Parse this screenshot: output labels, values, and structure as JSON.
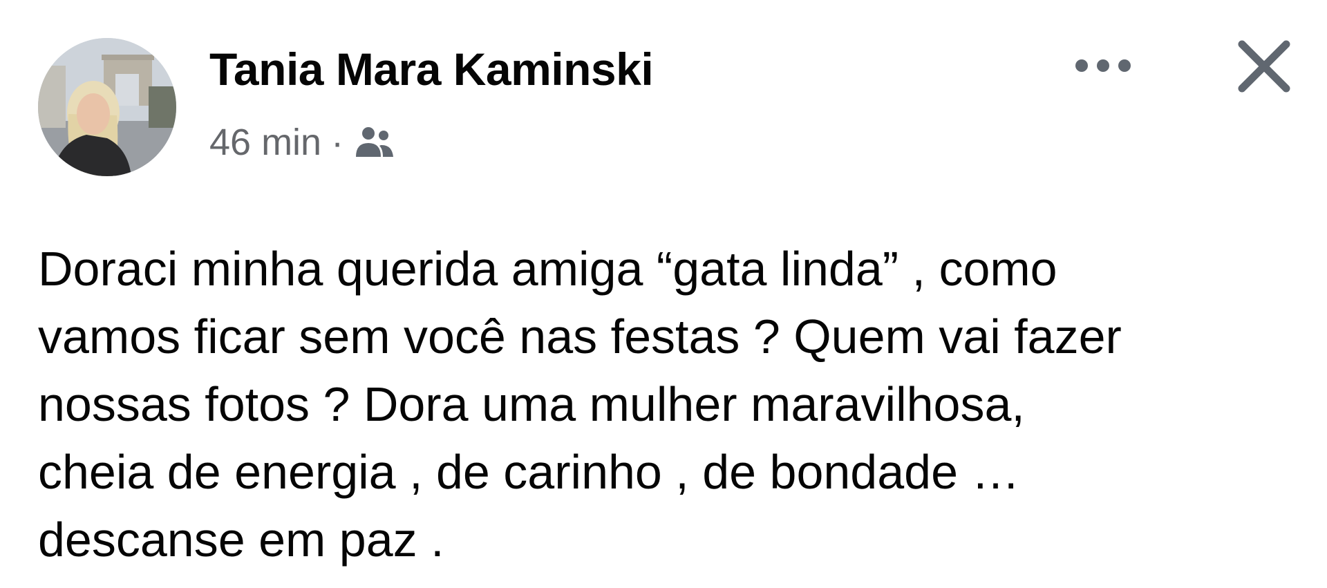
{
  "post": {
    "author_name": "Tania Mara Kaminski",
    "timestamp": "46 min",
    "separator": "·",
    "audience_icon": "friends-icon",
    "more_icon": "ellipsis-icon",
    "close_icon": "close-icon",
    "text_lines": [
      "Doraci minha querida amiga “gata linda” , como",
      "vamos ficar sem você nas festas ? Quem vai fazer",
      "nossas fotos ? Dora uma mulher maravilhosa,",
      "cheia de energia , de carinho , de bondade …",
      "descanse em paz ."
    ]
  },
  "colors": {
    "text": "#050505",
    "secondary_text": "#65676b",
    "icon": "#606770",
    "background": "#ffffff"
  }
}
